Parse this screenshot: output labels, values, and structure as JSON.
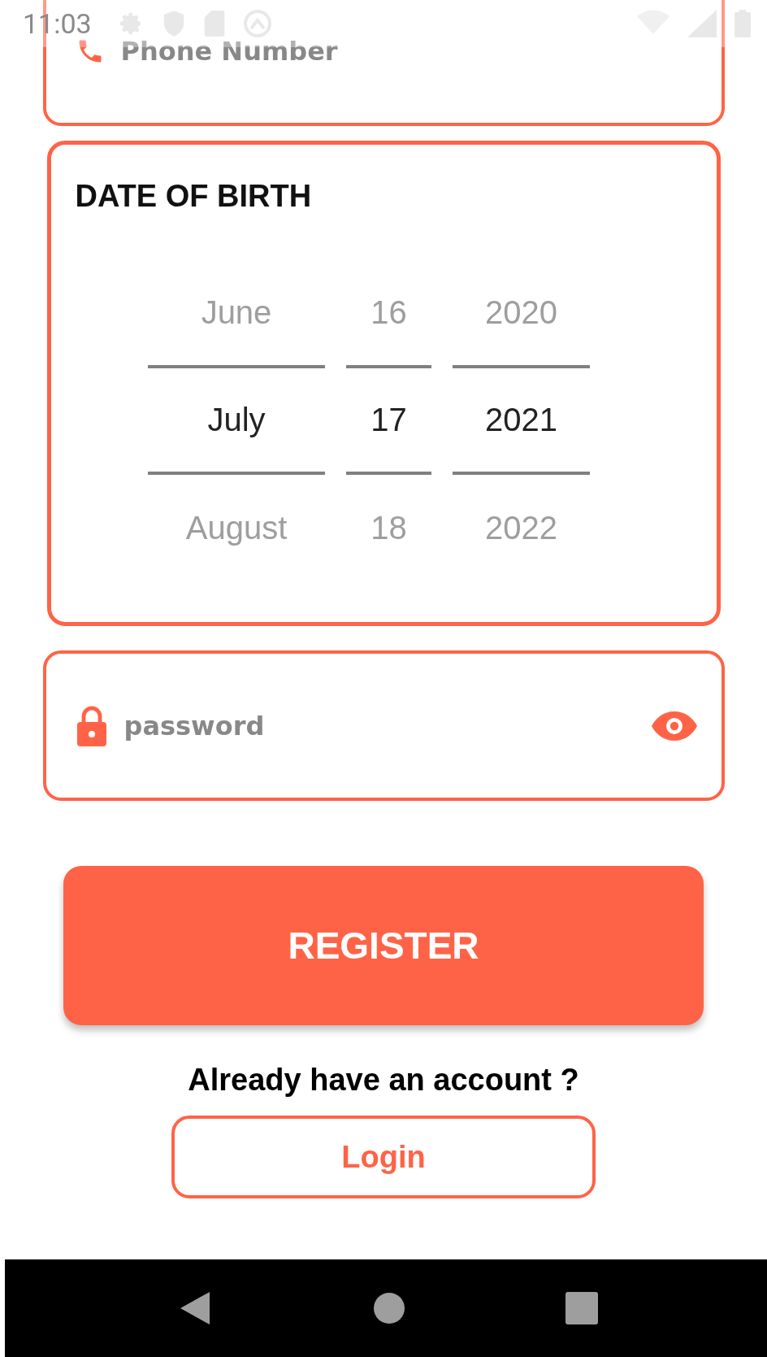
{
  "status_bar": {
    "time": "11:03"
  },
  "phone_field": {
    "placeholder": "Phone Number"
  },
  "date_of_birth": {
    "title": "DATE OF BIRTH",
    "columns": [
      {
        "kind": "month",
        "items": [
          {
            "label": "June",
            "selected": false
          },
          {
            "label": "July",
            "selected": true
          },
          {
            "label": "August",
            "selected": false
          }
        ]
      },
      {
        "kind": "day",
        "items": [
          {
            "label": "16",
            "selected": false
          },
          {
            "label": "17",
            "selected": true
          },
          {
            "label": "18",
            "selected": false
          }
        ]
      },
      {
        "kind": "year",
        "items": [
          {
            "label": "2020",
            "selected": false
          },
          {
            "label": "2021",
            "selected": true
          },
          {
            "label": "2022",
            "selected": false
          }
        ]
      }
    ]
  },
  "password_field": {
    "placeholder": "password"
  },
  "register_button": "REGISTER",
  "login_prompt": "Already have an account ?",
  "login_button": "Login"
}
